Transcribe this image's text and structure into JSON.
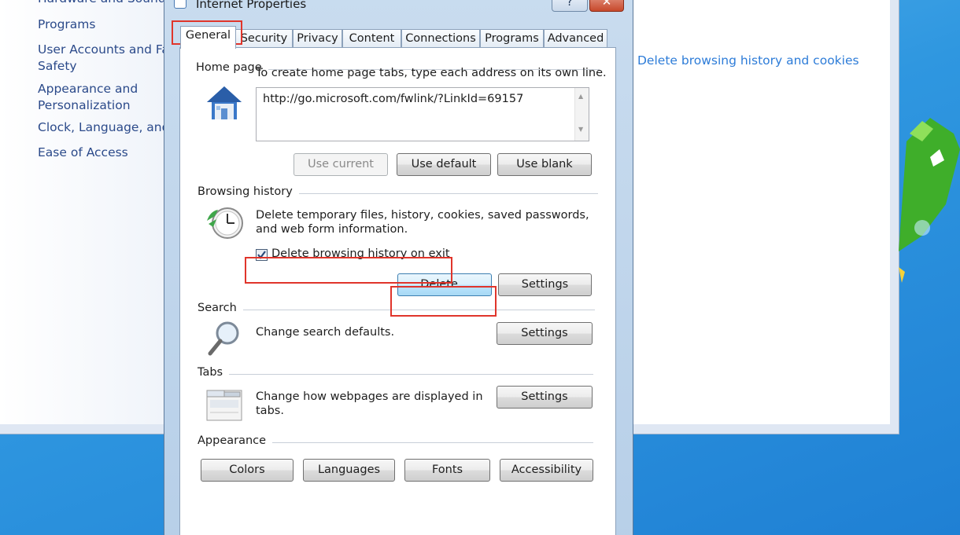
{
  "control_panel": {
    "left_links": [
      "Hardware and Sound",
      "Programs",
      "User Accounts and Fa",
      "Safety",
      "Appearance and",
      "Personalization",
      "Clock, Language, and",
      "Ease of Access"
    ],
    "right_link": "Delete browsing history and cookies"
  },
  "dialog": {
    "title": "Internet Properties",
    "help_label": "?",
    "close_label": "✕",
    "tabs": [
      "General",
      "Security",
      "Privacy",
      "Content",
      "Connections",
      "Programs",
      "Advanced"
    ],
    "active_tab": "General",
    "home_page": {
      "label": "Home page",
      "description": "To create home page tabs, type each address on its own line.",
      "url": "http://go.microsoft.com/fwlink/?LinkId=69157",
      "buttons": [
        "Use current",
        "Use default",
        "Use blank"
      ]
    },
    "browsing_history": {
      "label": "Browsing history",
      "description_line1": "Delete temporary files, history, cookies, saved passwords,",
      "description_line2": "and web form information.",
      "checkbox_label": "Delete browsing history on exit",
      "checkbox_checked": true,
      "delete_button": "Delete...",
      "settings_button": "Settings"
    },
    "search": {
      "label": "Search",
      "description": "Change search defaults.",
      "settings_button": "Settings"
    },
    "tabs_section": {
      "label": "Tabs",
      "description_line1": "Change how webpages are displayed in",
      "description_line2": "tabs.",
      "settings_button": "Settings"
    },
    "appearance": {
      "label": "Appearance",
      "buttons": [
        "Colors",
        "Languages",
        "Fonts",
        "Accessibility"
      ]
    }
  },
  "colors": {
    "highlight": "#e0352b",
    "link": "#2b4a8a",
    "desktop": "#2f97e0"
  }
}
